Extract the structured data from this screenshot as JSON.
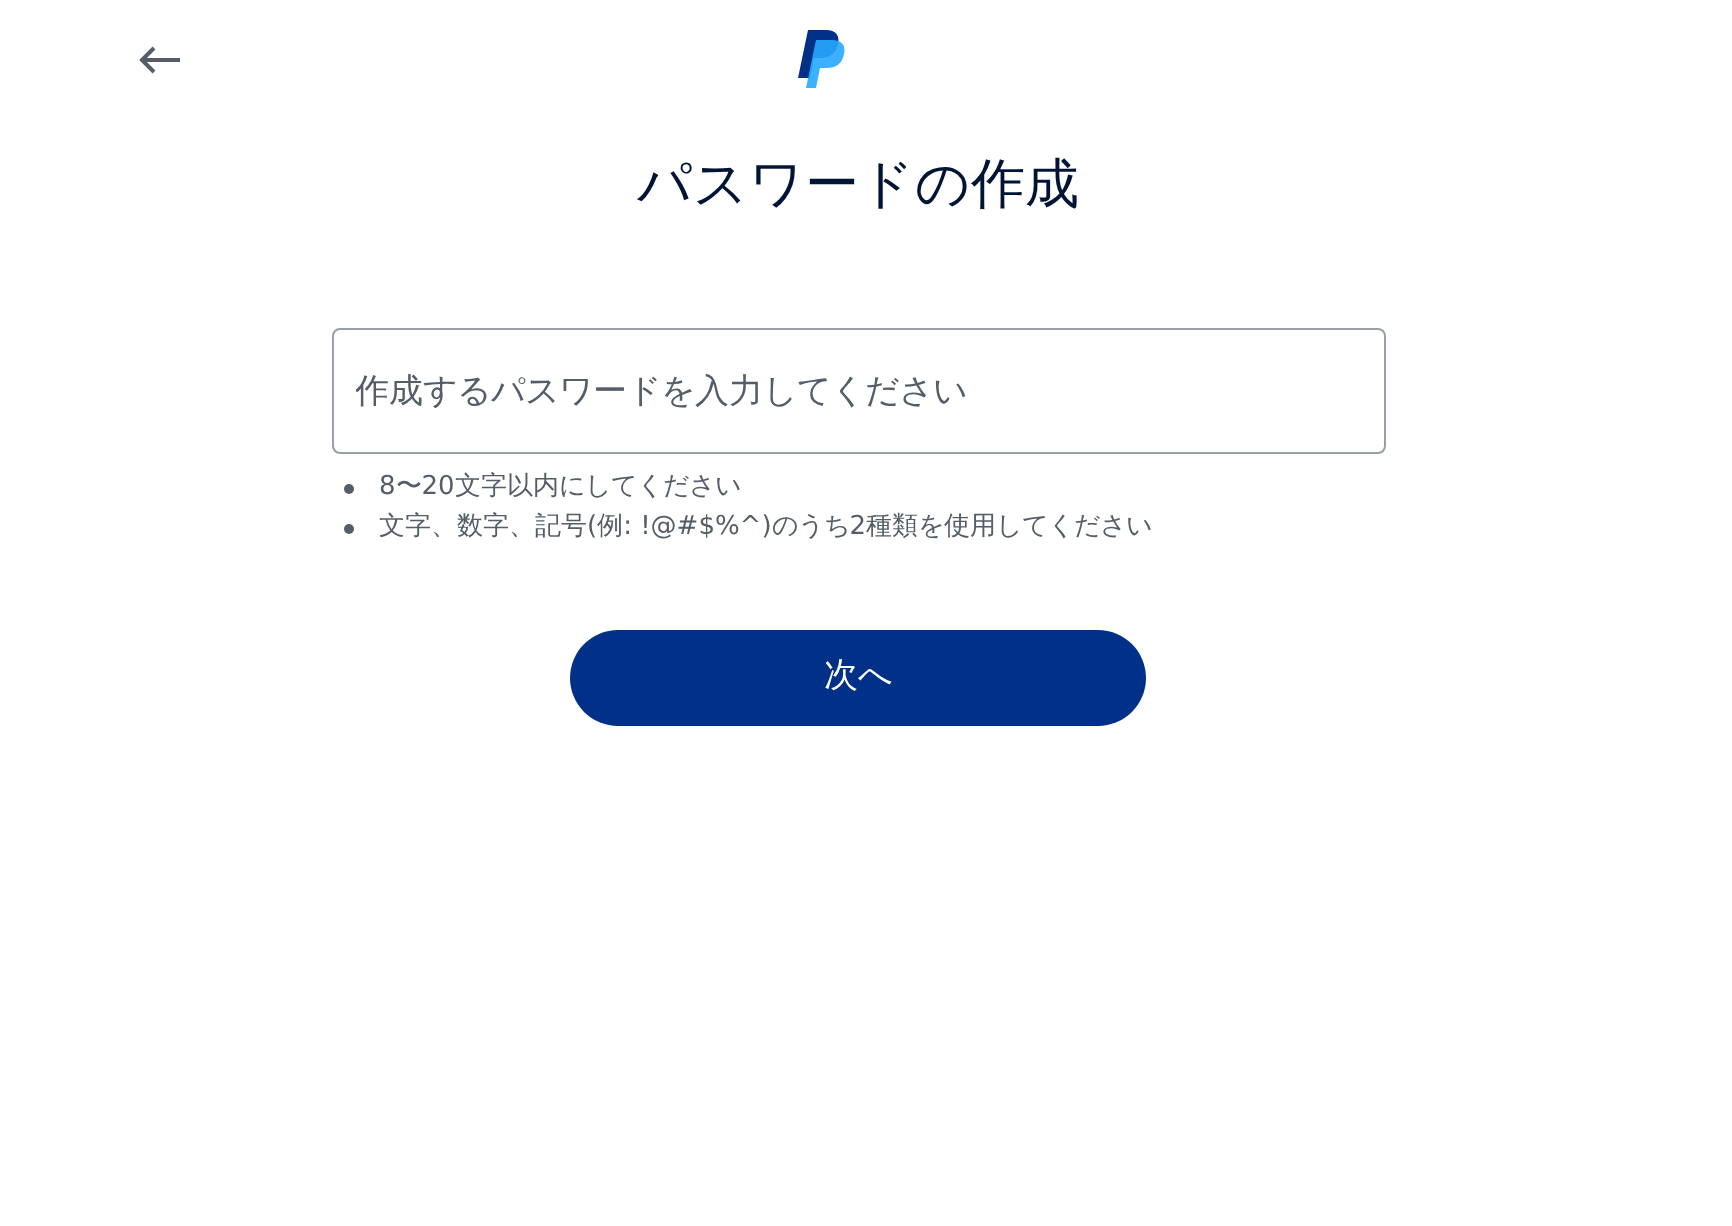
{
  "title": "パスワードの作成",
  "password_field": {
    "placeholder": "作成するパスワードを入力してください"
  },
  "hints": [
    "8〜20文字以内にしてください",
    "文字、数字、記号(例: !@#$%^)のうち2種類を使用してください"
  ],
  "next_button": {
    "label": "次へ"
  }
}
